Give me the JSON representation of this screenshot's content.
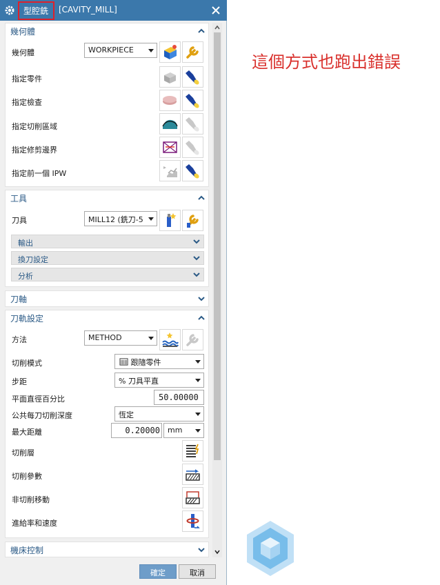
{
  "title": {
    "name": "型腔銑",
    "op": "[CAVITY_MILL]"
  },
  "sections": {
    "geometry": {
      "title": "幾何體",
      "geometry_label": "幾何體",
      "geometry_value": "WORKPIECE",
      "rows": [
        "指定零件",
        "指定檢查",
        "指定切削區域",
        "指定修剪邊界",
        "指定前一個 IPW"
      ]
    },
    "tool": {
      "title": "工具",
      "tool_label": "刀具",
      "tool_value": "MILL12 (銑刀-5",
      "subs": [
        "輸出",
        "換刀設定",
        "分析"
      ]
    },
    "axis": {
      "title": "刀軸"
    },
    "path": {
      "title": "刀軌設定",
      "method_label": "方法",
      "method_value": "METHOD",
      "cut_pattern_label": "切削模式",
      "cut_pattern_value": "跟隨零件",
      "stepover_label": "步距",
      "stepover_value": "% 刀具平直",
      "percent_label": "平面直徑百分比",
      "percent_value": "50.00000",
      "depth_label": "公共每刀切削深度",
      "depth_value": "恆定",
      "maxdist_label": "最大距離",
      "maxdist_value": "0.20000",
      "maxdist_unit": "mm",
      "levels_label": "切削層",
      "params_label": "切削參數",
      "noncut_label": "非切削移動",
      "feeds_label": "進給率和速度"
    },
    "machine": {
      "title": "機床控制"
    }
  },
  "footer": {
    "ok": "確定",
    "cancel": "取消"
  },
  "annotation": "這個方式也跑出錯誤",
  "colors": {
    "title_bar": "#3b78ab",
    "highlight": "#e0202a",
    "annotation": "#d9302c",
    "section_title": "#2b5a86"
  }
}
